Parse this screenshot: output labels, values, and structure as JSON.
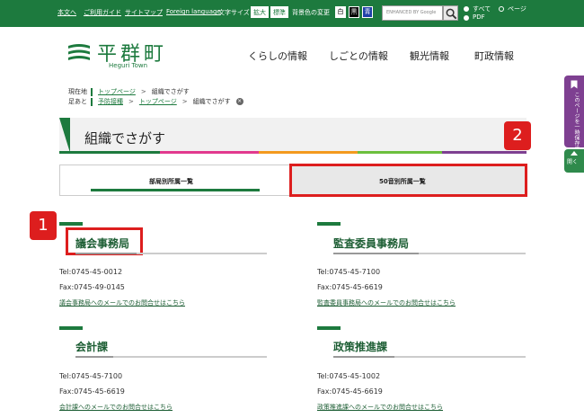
{
  "topbar": {
    "links": [
      "本文へ",
      "ご利用ガイド",
      "サイトマップ",
      "Foreign language"
    ],
    "font_size_label": "文字サイズ",
    "font_size_buttons": [
      "拡大",
      "標準"
    ],
    "bg_color_label": "背景色の変更",
    "bg_color_buttons": [
      "白",
      "黒",
      "青"
    ],
    "search_placeholder": "ENHANCED BY Google",
    "search_scope": [
      "すべて",
      "ページ",
      "PDF"
    ]
  },
  "header": {
    "logo_title": "平群町",
    "logo_subtitle": "Heguri Town",
    "nav": [
      "くらしの情報",
      "しごとの情報",
      "観光情報",
      "町政情報"
    ]
  },
  "side": {
    "bookmark_label": "このページを一時保存する",
    "open_label": "開く"
  },
  "breadcrumb": {
    "current_label": "現在地",
    "current_path": [
      "トップページ",
      "組織でさがす"
    ],
    "history_label": "足あと",
    "history_path": [
      "予防接種",
      "トップページ",
      "組織でさがす"
    ],
    "close_icon": "×"
  },
  "page": {
    "title": "組織でさがす"
  },
  "tabs": [
    "部局別所属一覧",
    "50音別所属一覧"
  ],
  "annotations": [
    "1",
    "2"
  ],
  "departments": [
    {
      "name": "議会事務局",
      "tel": "Tel:0745-45-0012",
      "fax": "Fax:0745-49-0145",
      "mail": "議会事務局へのメールでのお問合せはこちら"
    },
    {
      "name": "監査委員事務局",
      "tel": "Tel:0745-45-7100",
      "fax": "Fax:0745-45-6619",
      "mail": "監査委員事務局へのメールでのお問合せはこちら"
    },
    {
      "name": "会計課",
      "tel": "Tel:0745-45-7100",
      "fax": "Fax:0745-45-6619",
      "mail": "会計課へのメールでのお問合せはこちら"
    },
    {
      "name": "政策推進課",
      "tel": "Tel:0745-45-1002",
      "fax": "Fax:0745-45-6619",
      "mail": "政策推進課へのメールでのお問合せはこちら"
    }
  ],
  "colors": {
    "brand_green": "#1d7a3e",
    "annotation_red": "#dd1e1e",
    "side_purple": "#7e4091"
  }
}
